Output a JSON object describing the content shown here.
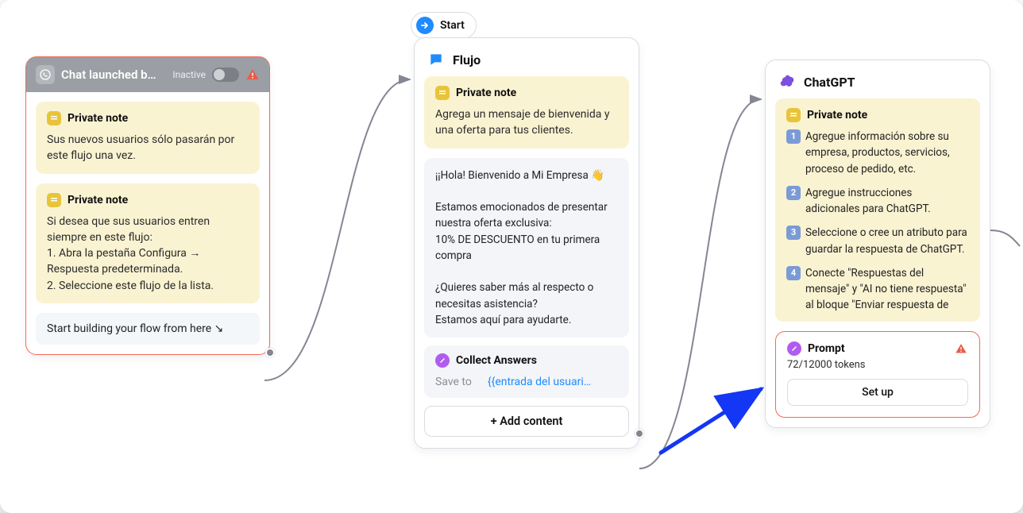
{
  "start": {
    "label": "Start"
  },
  "card1": {
    "header": {
      "title": "Chat launched b…",
      "status": "Inactive"
    },
    "note1": {
      "title": "Private note",
      "body": "Sus nuevos usuarios sólo pasarán por este flujo una vez."
    },
    "note2": {
      "title": "Private note",
      "body": "Si desea que sus usuarios entren siempre en este flujo:\n1. Abra la pestaña Configura → Respuesta predeterminada.\n2. Seleccione este flujo de la lista."
    },
    "start_row": "Start building your flow from here ↘"
  },
  "card2": {
    "title": "Flujo",
    "note": {
      "title": "Private note",
      "body": "Agrega un mensaje de bienvenida y una oferta para tus clientes."
    },
    "message": "¡¡Hola! Bienvenido a Mi Empresa 👋\n\nEstamos emocionados de presentar nuestra oferta exclusiva:\n10% DE DESCUENTO en tu primera compra\n\n¿Quieres saber más al respecto o necesitas asistencia?\nEstamos aquí para ayudarte.",
    "collect": {
      "title": "Collect Answers",
      "save_label": "Save to",
      "save_value": "{{entrada del usuari…"
    },
    "add_content": "+ Add content"
  },
  "card3": {
    "title": "ChatGPT",
    "note_title": "Private note",
    "items": [
      "Agregue información sobre su empresa, productos, servicios, proceso de pedido, etc.",
      "Agregue instrucciones adicionales para ChatGPT.",
      "Seleccione o cree un atributo para guardar la respuesta de ChatGPT.",
      "Conecte \"Respuestas del mensaje\" y \"AI no tiene respuesta\" al bloque \"Enviar respuesta de"
    ],
    "prompt": {
      "title": "Prompt",
      "tokens": "72/12000 tokens",
      "setup": "Set up"
    }
  },
  "colors": {
    "accent_blue": "#1f8bff",
    "warn_red": "#F26A5A",
    "note_bg": "#FAF3D2",
    "purple": "#B15CF0",
    "arrow_blue": "#1436F5"
  }
}
